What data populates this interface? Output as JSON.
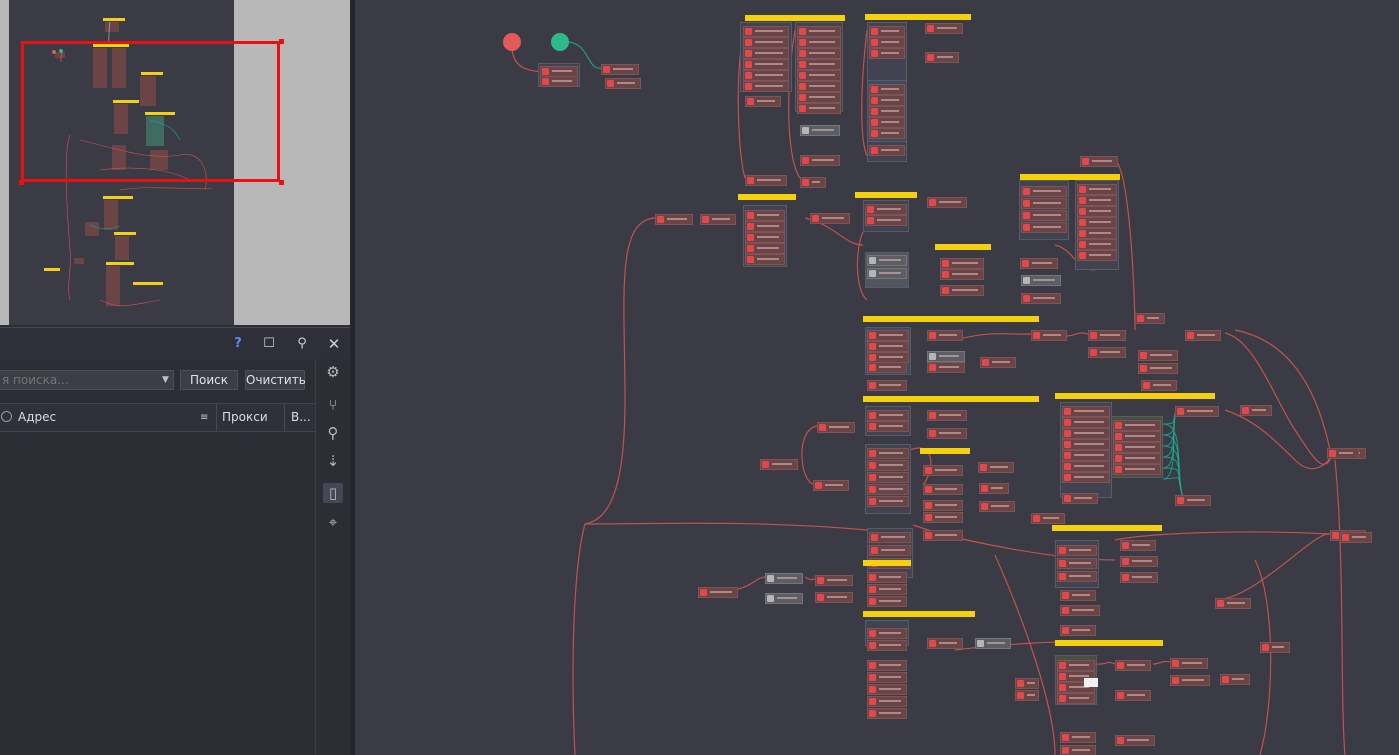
{
  "panel": {
    "header_buttons": {
      "help": "?",
      "maximize_icon": "square-icon",
      "pin_icon": "pin-icon",
      "close_icon": "close-icon"
    },
    "search": {
      "placeholder": "я поиска...",
      "search_button": "Поиск",
      "clear_button": "Очистить"
    },
    "table": {
      "columns": [
        "Адрес",
        "Прокси",
        "В..."
      ],
      "rows": []
    },
    "side_tools": [
      "settings-icon",
      "branch-icon",
      "search-icon",
      "sort-icon",
      "device-icon",
      "tag-icon"
    ]
  },
  "colors": {
    "canvas_bg": "#3a3b45",
    "node_red": "#e0484b",
    "node_body": "#6b4446",
    "group_label": "#f4d10a",
    "connection": "#d0554f",
    "connection_alt": "#1fa58c",
    "minimap_viewport": "#e81010",
    "start_node_red": "#e05a5a",
    "start_node_green": "#2fb88a"
  }
}
